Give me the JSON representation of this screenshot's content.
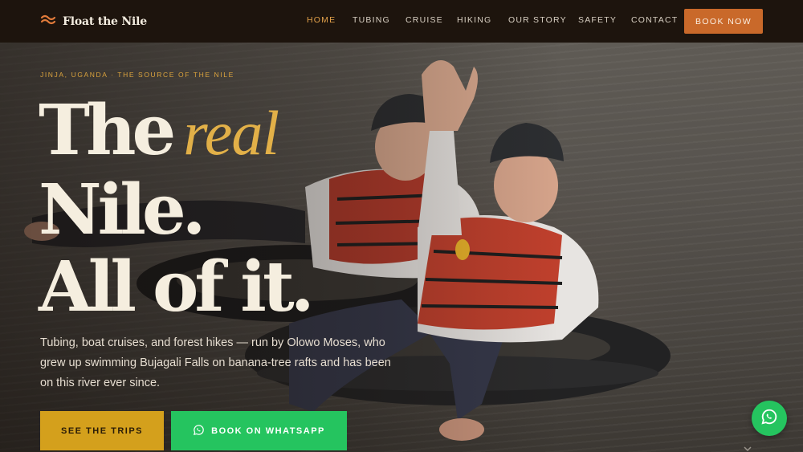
{
  "brand": {
    "name": "Float the Nile",
    "logo_icon": "wave-logo-icon",
    "logo_color": "#e07a3a"
  },
  "nav": {
    "items": [
      {
        "label": "HOME",
        "active": true
      },
      {
        "label": "TUBING",
        "active": false
      },
      {
        "label": "CRUISE",
        "active": false
      },
      {
        "label": "HIKING",
        "active": false
      },
      {
        "label": "OUR STORY",
        "active": false
      },
      {
        "label": "SAFETY",
        "active": false
      },
      {
        "label": "CONTACT",
        "active": false
      }
    ],
    "book_label": "BOOK NOW"
  },
  "hero": {
    "eyebrow": "JINJA, UGANDA · THE SOURCE OF THE NILE",
    "headline": {
      "line1": "The",
      "accent": "real",
      "line2": "Nile.",
      "line3": "All of it."
    },
    "lead": "Tubing, boat cruises, and forest hikes — run by Olowo Moses, who grew up swimming Bujagali Falls on banana-tree rafts and has been on this river ever since.",
    "cta_primary": "SEE THE TRIPS",
    "cta_secondary": "BOOK ON WHATSAPP",
    "cta_secondary_icon": "whatsapp-icon"
  },
  "floating": {
    "whatsapp_icon": "whatsapp-icon",
    "scroll_icon": "chevron-down-icon"
  },
  "colors": {
    "header_bg": "#1d140d",
    "accent_orange": "#c9692a",
    "accent_gold": "#d4a01c",
    "whatsapp_green": "#25c45f",
    "nav_active": "#e1a04a"
  }
}
